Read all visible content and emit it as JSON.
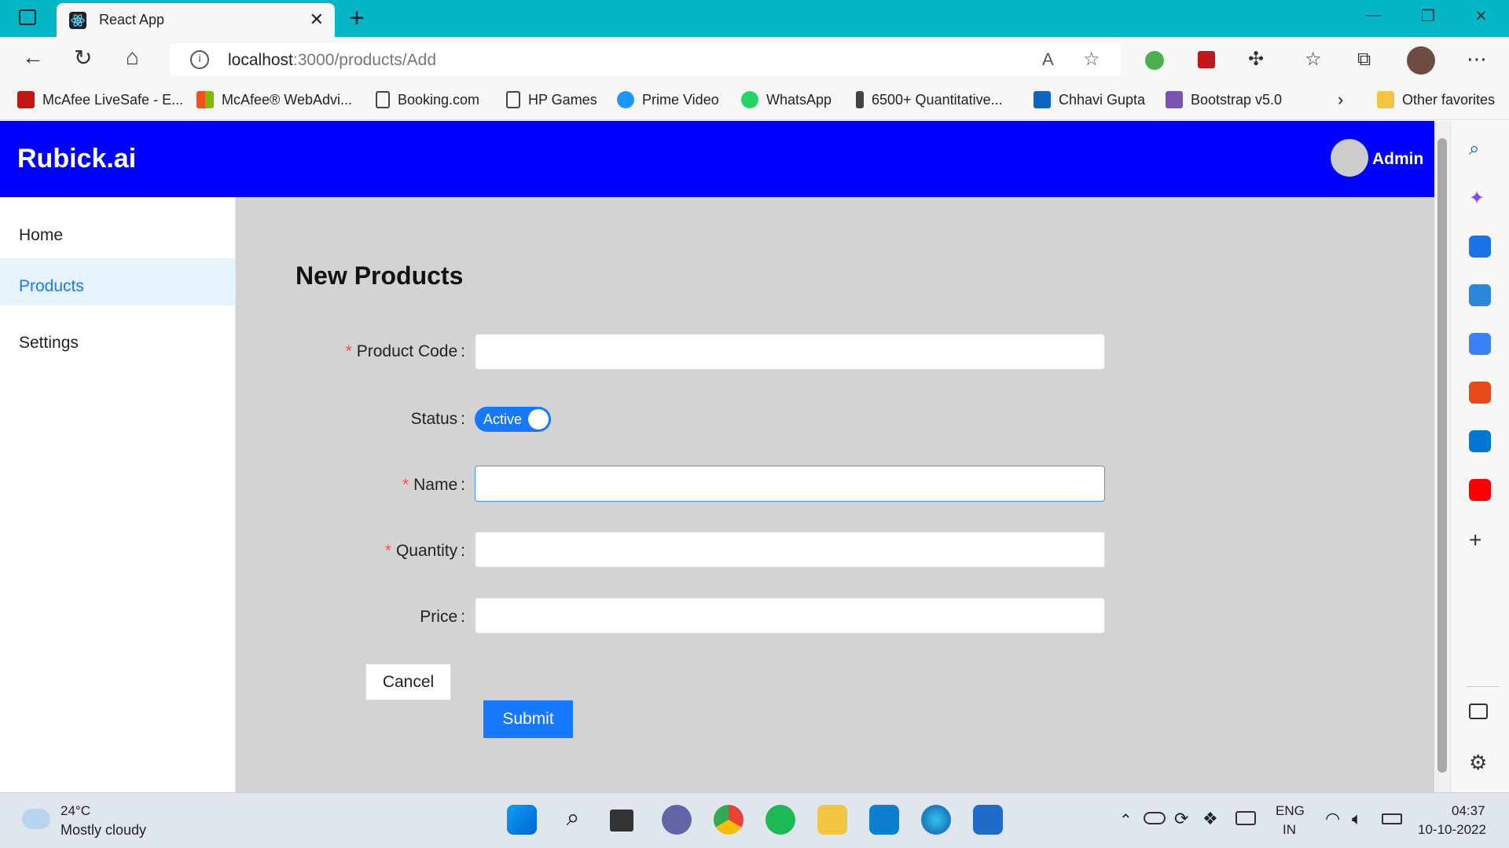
{
  "browser": {
    "tab_title": "React App",
    "tab_close": "✕",
    "new_tab": "+",
    "url_host": "localhost",
    "url_rest": ":3000/products/Add",
    "favorites": [
      {
        "label": "McAfee LiveSafe - E...",
        "color": "#c01818"
      },
      {
        "label": "McAfee® WebAdvi...",
        "color": "#f25022"
      },
      {
        "label": "Booking.com",
        "color": "#ffffff"
      },
      {
        "label": "HP Games",
        "color": "#ffffff"
      },
      {
        "label": "Prime Video",
        "color": "#1a98ff"
      },
      {
        "label": "WhatsApp",
        "color": "#25d366"
      },
      {
        "label": "6500+ Quantitative...",
        "color": "#444444"
      },
      {
        "label": "Chhavi Gupta",
        "color": "#0a66c2"
      },
      {
        "label": "Bootstrap v5.0",
        "color": "#7952b3"
      }
    ],
    "other_favorites": "Other favorites"
  },
  "app": {
    "brand": "Rubick.ai",
    "user_name": "Admin",
    "sidebar": [
      {
        "label": "Home",
        "active": false
      },
      {
        "label": "Products",
        "active": true
      },
      {
        "label": "Settings",
        "active": false
      }
    ],
    "page_title": "New Products",
    "form": {
      "product_code_label": "Product Code",
      "status_label": "Status",
      "status_value": "Active",
      "name_label": "Name",
      "quantity_label": "Quantity",
      "price_label": "Price",
      "required_mark": "*",
      "colon": ":",
      "cancel_label": "Cancel",
      "submit_label": "Submit"
    },
    "accent_color": "#1677ff",
    "header_color": "#0000ff"
  },
  "taskbar": {
    "weather_temp": "24°C",
    "weather_desc": "Mostly cloudy",
    "lang_top": "ENG",
    "lang_bottom": "IN",
    "time": "04:37",
    "date": "10-10-2022"
  }
}
